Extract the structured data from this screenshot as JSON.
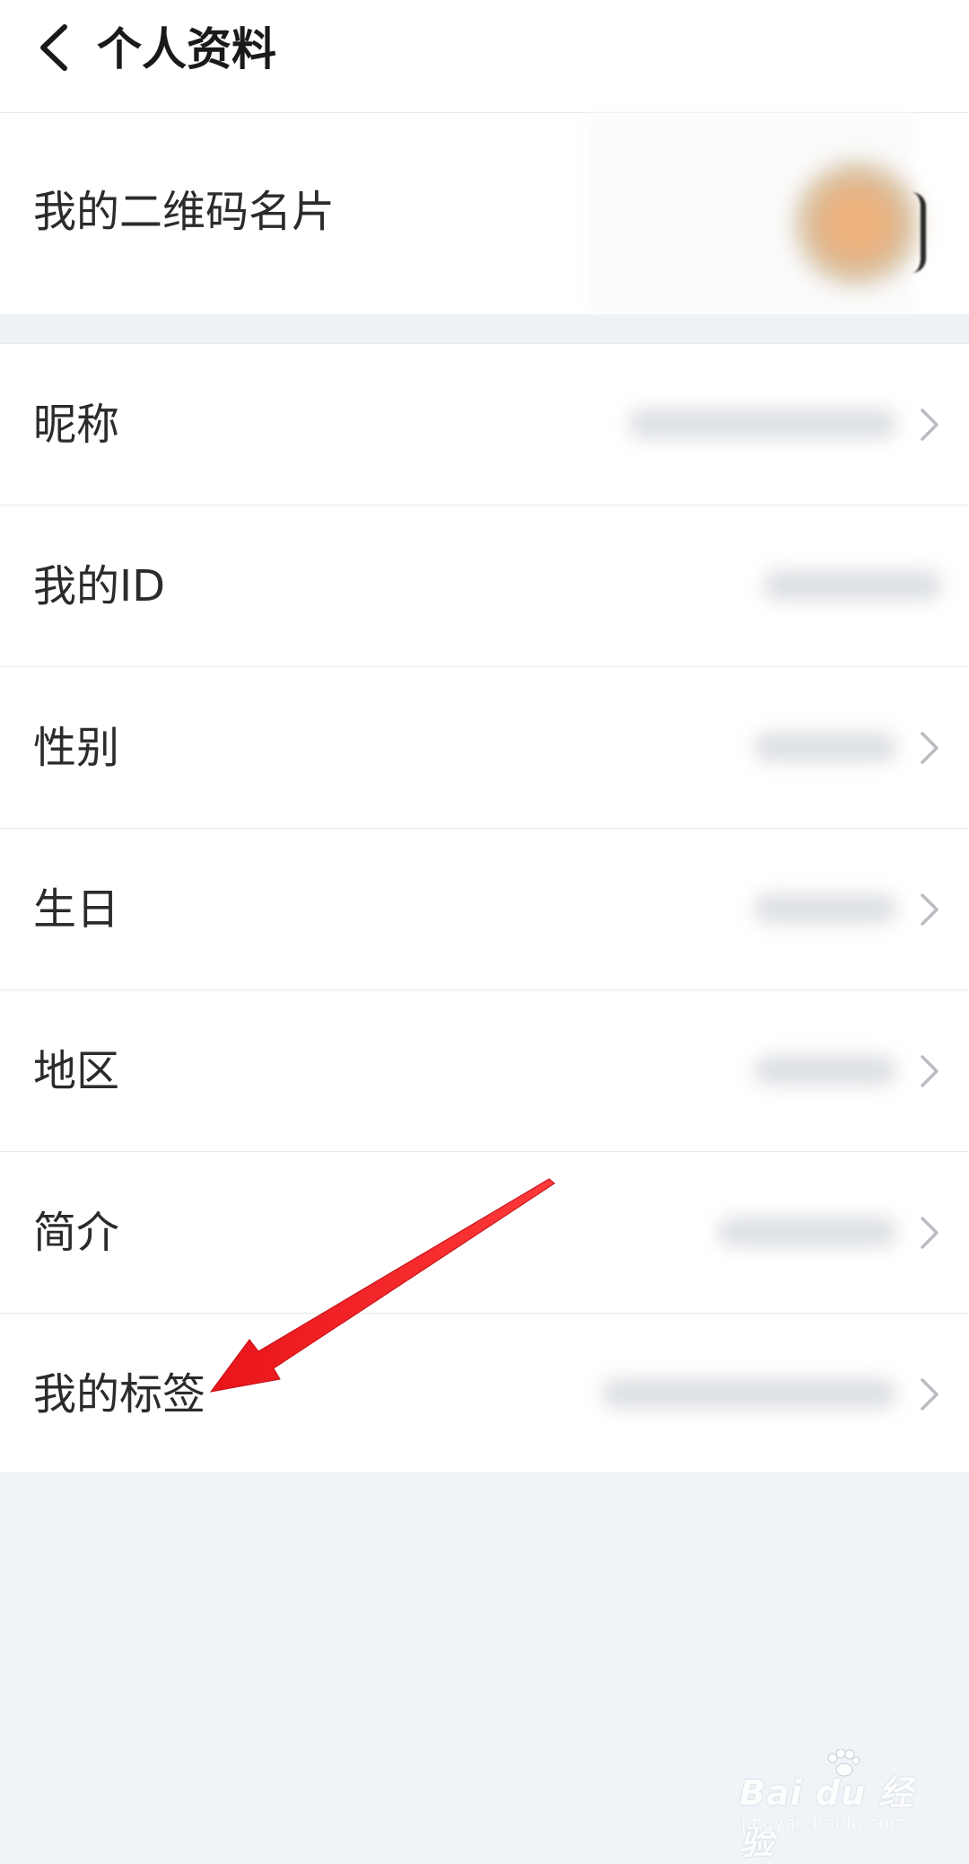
{
  "header": {
    "back_icon": "chevron-left-icon",
    "title": "个人资料"
  },
  "qr_card": {
    "label": "我的二维码名片",
    "avatar_icon": "avatar"
  },
  "rows": [
    {
      "label": "我的ID",
      "has_chevron": false
    },
    {
      "label": "昵称",
      "has_chevron": true
    },
    {
      "label": "性别",
      "has_chevron": true
    },
    {
      "label": "生日",
      "has_chevron": true
    },
    {
      "label": "地区",
      "has_chevron": true
    },
    {
      "label": "简介",
      "has_chevron": true
    },
    {
      "label": "我的标签",
      "has_chevron": true
    }
  ],
  "list_items": {
    "nickname": "昵称",
    "my_id": "我的ID",
    "gender": "性别",
    "birthday": "生日",
    "region": "地区",
    "bio": "简介",
    "my_tags": "我的标签"
  },
  "annotation": {
    "arrow_color": "#e8141a",
    "arrow_icon": "red-arrow-icon"
  },
  "watermark": {
    "main": "Bai du 经验",
    "sub": "jingyan.baidu.com"
  },
  "colors": {
    "background": "#f0f3f7",
    "card": "#ffffff",
    "divider": "#e7e9ec",
    "text": "#2b2b2b",
    "chevron": "#b9bcc1"
  }
}
